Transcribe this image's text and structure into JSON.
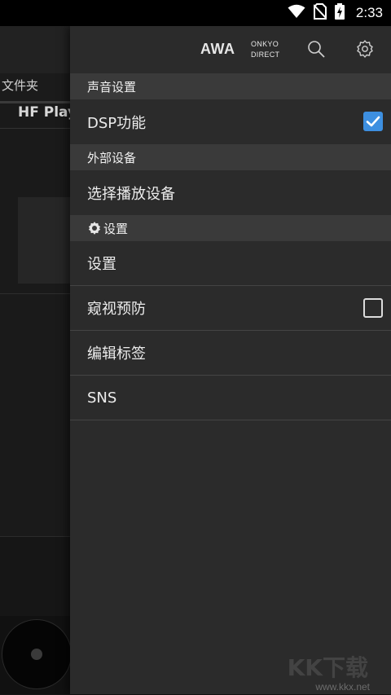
{
  "status_bar": {
    "time": "2:33",
    "icons": [
      "wifi-icon",
      "no-sim-icon",
      "battery-charging-icon"
    ]
  },
  "background_app": {
    "tab_label": "文件夹",
    "list_title": "HF Play"
  },
  "drawer": {
    "header": {
      "awa_label": "AWA",
      "onkyo_line1": "ONKYO",
      "onkyo_line2": "DIRECT",
      "search_icon": "search-icon",
      "settings_icon": "gear-icon"
    },
    "sections": [
      {
        "title": "声音设置"
      },
      {
        "title": "外部设备"
      },
      {
        "title": "设置"
      }
    ],
    "items": {
      "dsp": {
        "label": "DSP功能",
        "checked": true
      },
      "select_device": {
        "label": "选择播放设备"
      },
      "settings": {
        "label": "设置"
      },
      "peek_protect": {
        "label": "窥视预防",
        "checked": false
      },
      "edit_tags": {
        "label": "编辑标签"
      },
      "sns": {
        "label": "SNS"
      }
    }
  },
  "watermark": {
    "text": "www.kkx.net",
    "logo": "KK下载"
  },
  "colors": {
    "accent": "#3d8fe0",
    "drawer_bg": "#2b2b2b",
    "section_bg": "#3a3a3a"
  }
}
